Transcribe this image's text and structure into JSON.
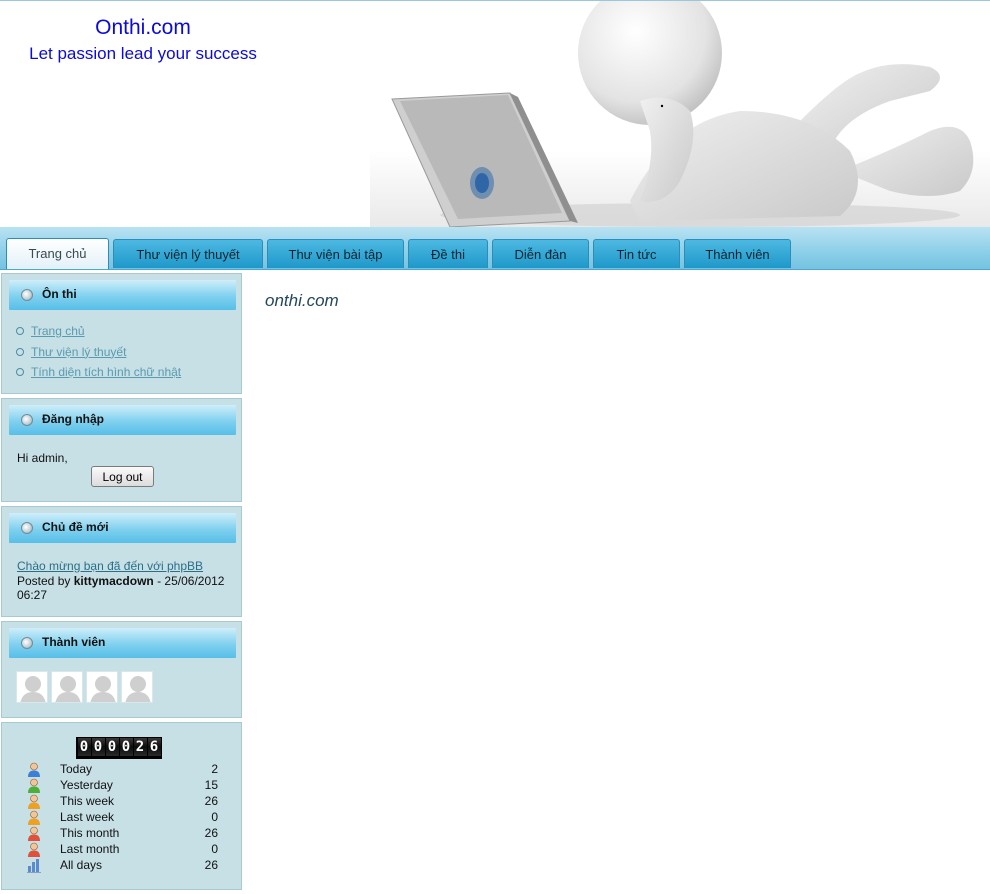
{
  "site": {
    "title": "Onthi.com",
    "slogan": "Let passion lead your success"
  },
  "nav": {
    "tabs": [
      {
        "label": "Trang chủ",
        "active": true
      },
      {
        "label": "Thư viện lý thuyết"
      },
      {
        "label": "Thư viện bài tập"
      },
      {
        "label": "Đề thi"
      },
      {
        "label": "Diễn đàn"
      },
      {
        "label": "Tin tức"
      },
      {
        "label": "Thành viên"
      }
    ]
  },
  "sidebar": {
    "onthi": {
      "title": "Ôn thi",
      "links": [
        "Trang chủ",
        "Thư viện lý thuyết",
        "Tính diện tích hình chữ nhật"
      ]
    },
    "login": {
      "title": "Đăng nhập",
      "greeting": "Hi admin,",
      "logout_label": "Log out"
    },
    "topics": {
      "title": "Chủ đề mới",
      "post_title": "Chào mừng bạn đã đến với phpBB",
      "posted_by": "Posted by",
      "author": "kittymacdown",
      "date": "- 25/06/2012 06:27"
    },
    "members": {
      "title": "Thành viên"
    },
    "visitors": {
      "counter": [
        "0",
        "0",
        "0",
        "0",
        "2",
        "6"
      ],
      "rows": [
        {
          "label": "Today",
          "value": "2",
          "icon": "user-blue-icon"
        },
        {
          "label": "Yesterday",
          "value": "15",
          "icon": "user-green-icon"
        },
        {
          "label": "This week",
          "value": "26",
          "icon": "user-orange-icon"
        },
        {
          "label": "Last week",
          "value": "0",
          "icon": "user-orange-icon"
        },
        {
          "label": "This month",
          "value": "26",
          "icon": "user-red-icon"
        },
        {
          "label": "Last month",
          "value": "0",
          "icon": "user-red-icon"
        },
        {
          "label": "All days",
          "value": "26",
          "icon": "bar-chart-icon"
        }
      ]
    }
  },
  "main": {
    "title": "onthi.com"
  },
  "colors": {
    "link": "#5a9ab0",
    "panel_bg": "#c7e0e6",
    "tab_bg": "#1e98c9",
    "brand_text": "#0b0bd8"
  }
}
